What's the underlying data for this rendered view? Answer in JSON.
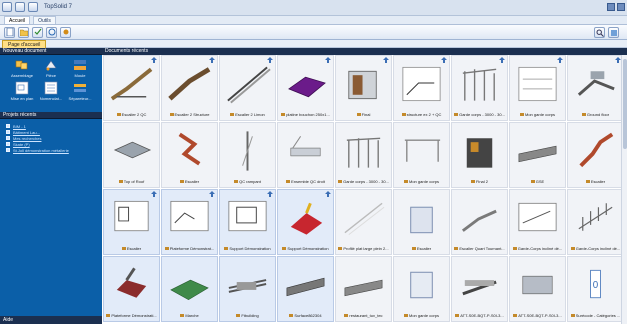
{
  "app": {
    "title": "TopSolid 7"
  },
  "menubar": {
    "tabs": [
      "Accueil",
      "Outils"
    ]
  },
  "page_tab": "Page d'accueil",
  "left": {
    "new_doc_header": "Nouveau document",
    "tools_row1": [
      {
        "label": "Assemblage",
        "icon": "assembly-icon"
      },
      {
        "label": "Pièce",
        "icon": "part-icon"
      },
      {
        "label": "Moule",
        "icon": "mold-icon"
      }
    ],
    "tools_row2": [
      {
        "label": "Mise en plan",
        "icon": "drawing-icon"
      },
      {
        "label": "Nomenclat...",
        "icon": "bom-icon"
      },
      {
        "label": "Sépareteur...",
        "icon": "separator-icon"
      }
    ],
    "recent_header": "Projets récents",
    "recent_items": [
      "BIM - 1",
      "Bâtiment Lau...",
      "Mes recherches",
      "Skate (P)",
      "St.Joll démonstration métallerie"
    ],
    "bottom_header": "Aide"
  },
  "main": {
    "header": "Documents récents",
    "tiles": [
      "Escalier 2 QC",
      "Escalier 2 Structure",
      "Escalier 2 Limon",
      "platine bouchon 250x1...",
      "Final",
      "structure ex 2 + QC",
      "Garde corps - 3000 - 30...",
      "Mon garde corps",
      "Ground floor",
      "Top of Roof",
      "Escalier",
      "QC rampant",
      "Ensemble QC droit",
      "Garde corps - 3000 - 30...",
      "Mon garde corps",
      "Final 2",
      "GSE",
      "Escalier",
      "Escalier",
      "Plateforme Démonstrat...",
      "Support Démonstration",
      "Support Démonstration",
      "Profilé plat large plein 2...",
      "Escalier",
      "Escalier Quart Tournant...",
      "Garde-Corps incliné dé...",
      "Garde-Corps incliné dé...",
      "Plateforme Démonstrati...",
      "Marche",
      "Ftbuilding",
      "Surface862304",
      "restaurant_tuv_tec",
      "Mon garde corps",
      "ATT-S0E-BQT-P-S0I-3...",
      "ATT-S0E-BQT-P-S0I-3...",
      "Surécode - Catégories ..."
    ]
  }
}
